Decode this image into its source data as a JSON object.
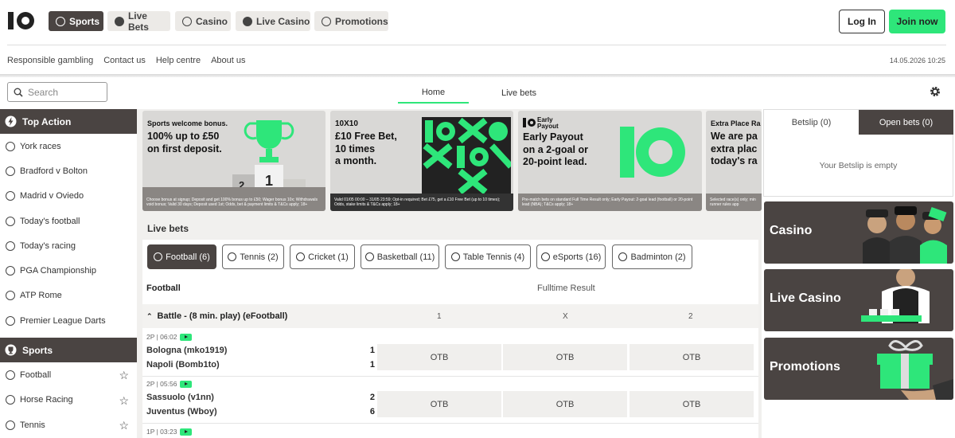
{
  "nav": {
    "items": [
      {
        "label": "Sports",
        "icon": "soccer-ball-icon",
        "active": true
      },
      {
        "label": "Live Bets",
        "icon": "live-icon",
        "active": false
      },
      {
        "label": "Casino",
        "icon": "casino-chip-icon",
        "active": false
      },
      {
        "label": "Live Casino",
        "icon": "live-casino-icon",
        "active": false
      },
      {
        "label": "Promotions",
        "icon": "promotions-icon",
        "active": false
      }
    ],
    "login_label": "Log In",
    "join_label": "Join now"
  },
  "links": [
    "Responsible gambling",
    "Contact us",
    "Help centre",
    "About us"
  ],
  "datetime": "14.05.2026 10:25",
  "search": {
    "placeholder": "Search"
  },
  "main_tabs": [
    {
      "label": "Home",
      "active": true
    },
    {
      "label": "Live bets",
      "active": false
    }
  ],
  "sidebar": {
    "top_action": {
      "title": "Top Action",
      "items": [
        "York races",
        "Bradford v Bolton",
        "Madrid v Oviedo",
        "Today's football",
        "Today's racing",
        "PGA Championship",
        "ATP Rome",
        "Premier League Darts"
      ]
    },
    "sports": {
      "title": "Sports",
      "items": [
        "Football",
        "Horse Racing",
        "Tennis"
      ]
    }
  },
  "promos": [
    {
      "title": "Sports welcome bonus.",
      "headline": "100% up to £50\non first deposit.",
      "fine": "Choose bonus at signup; Deposit and get 100% bonus up to £50; Wager bonus 10x; Withdrawals void bonus; Valid 30 days; Deposit used 1st; Odds, bet & payment limits & T&Cs apply; 18+"
    },
    {
      "title": "10X10",
      "headline": "£10 Free Bet,\n10 times\na month.",
      "fine": "Valid 01/05 00:00 – 31/05 23:59; Opt-in required; Bet £75, get a £10 Free Bet (up to 10 times); Odds, stake limits & T&Cs apply; 18+"
    },
    {
      "title": "Early Payout",
      "headline": "Early Payout\non a 2-goal or\n20-point lead.",
      "fine": "Pre-match bets on standard Full Time Result only; Early Payout: 2-goal lead (football) or 20-point lead (NBA); T&Cs apply; 18+"
    },
    {
      "title": "Extra Place Ra",
      "headline": "We are pa\nextra plac\ntoday's ra",
      "fine": "Selected race(s) only; min runner rules app"
    }
  ],
  "live_bets_label": "Live bets",
  "sport_pills": [
    {
      "label": "Football (6)",
      "active": true
    },
    {
      "label": "Tennis (2)",
      "active": false
    },
    {
      "label": "Cricket (1)",
      "active": false
    },
    {
      "label": "Basketball (11)",
      "active": false
    },
    {
      "label": "Table Tennis (4)",
      "active": false
    },
    {
      "label": "eSports (16)",
      "active": false
    },
    {
      "label": "Badminton (2)",
      "active": false
    }
  ],
  "table": {
    "sport_heading": "Football",
    "market_heading": "Fulltime Result",
    "group": "Battle - (8 min. play) (eFootball)",
    "cols": [
      "1",
      "X",
      "2"
    ],
    "matches": [
      {
        "time": "2P | 06:02",
        "home": "Bologna (mko1919)",
        "away": "Napoli (Bomb1to)",
        "home_score": "1",
        "away_score": "1",
        "odds": [
          "OTB",
          "OTB",
          "OTB"
        ]
      },
      {
        "time": "2P | 05:56",
        "home": "Sassuolo (v1nn)",
        "away": "Juventus (Wboy)",
        "home_score": "2",
        "away_score": "6",
        "odds": [
          "OTB",
          "OTB",
          "OTB"
        ]
      },
      {
        "time": "1P | 03:23"
      }
    ]
  },
  "betslip": {
    "tab1": "Betslip (0)",
    "tab2": "Open bets (0)",
    "empty": "Your Betslip is empty"
  },
  "cards": [
    "Casino",
    "Live Casino",
    "Promotions"
  ],
  "colors": {
    "brand_green": "#2ee67a",
    "dark": "#4a4442"
  }
}
